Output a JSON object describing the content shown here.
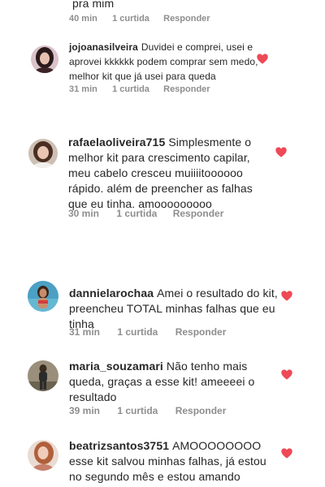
{
  "colors": {
    "text": "#262626",
    "meta": "#8e8e8e",
    "heart": "#ed4956"
  },
  "comments": [
    {
      "username": "",
      "text": "pra mim",
      "time": "40 min",
      "likes": "1 curtida",
      "reply": "Responder",
      "liked": false
    },
    {
      "username": "jojoanasilveira",
      "text": "Duvidei e comprei, usei e aprovei kkkkkk podem comprar sem medo, melhor kit que já usei para queda",
      "time": "31 min",
      "likes": "1 curtida",
      "reply": "Responder",
      "liked": true,
      "avatar_icon": "profile-photo"
    },
    {
      "username": "rafaelaoliveira715",
      "text": "Simplesmente o melhor kit para crescimento capilar, meu cabelo cresceu muiiiitoooooo rápido. além de preencher as falhas que eu tinha. amooooooooo",
      "time": "30 min",
      "likes": "1 curtida",
      "reply": "Responder",
      "liked": true,
      "avatar_icon": "profile-photo"
    },
    {
      "username": "dannielarochaa",
      "text": "Amei o resultado do kit, preencheu TOTAL minhas falhas que eu tinha",
      "time": "31 min",
      "likes": "1 curtida",
      "reply": "Responder",
      "liked": true,
      "avatar_icon": "profile-photo"
    },
    {
      "username": "maria_souzamari",
      "text": "Não tenho mais queda, graças a esse kit! ameeeei o resultado",
      "time": "39 min",
      "likes": "1 curtida",
      "reply": "Responder",
      "liked": true,
      "avatar_icon": "profile-photo"
    },
    {
      "username": "beatrizsantos3751",
      "text": "AMOOOOOOOO esse kit salvou minhas falhas, já estou no segundo mês e estou amando",
      "time": "",
      "likes": "",
      "reply": "",
      "liked": true,
      "avatar_icon": "profile-photo"
    }
  ]
}
